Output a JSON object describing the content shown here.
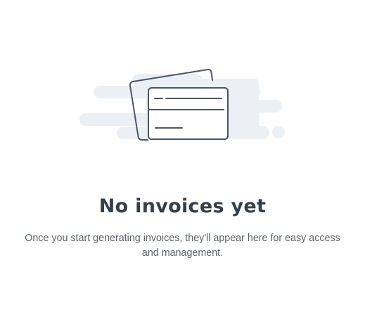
{
  "empty_state": {
    "illustration_icon": "credit-card-icon",
    "title": "No invoices yet",
    "description": "Once you start generating invoices, they'll appear here for easy access and management."
  },
  "colors": {
    "title": "#34404b",
    "description": "#5c636b",
    "illustration_stroke": "#4a5568",
    "illustration_cloud": "#eaf0f4"
  }
}
